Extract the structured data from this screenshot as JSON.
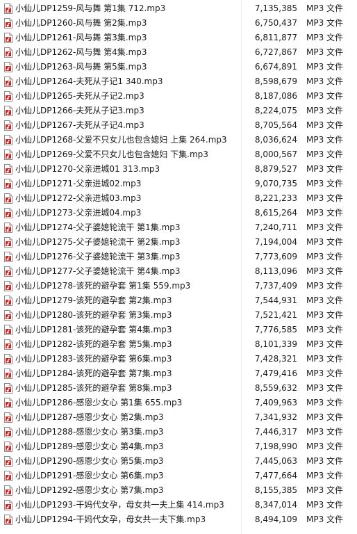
{
  "files": [
    {
      "name": "小仙儿DP1259-风与舞 第1集 712.mp3",
      "size": "7,135,385",
      "type": "MP3 文件",
      "icon": "mp3-file-icon"
    },
    {
      "name": "小仙儿DP1260-风与舞 第2集.mp3",
      "size": "6,750,437",
      "type": "MP3 文件",
      "icon": "mp3-file-icon"
    },
    {
      "name": "小仙儿DP1261-风与舞 第3集.mp3",
      "size": "6,811,877",
      "type": "MP3 文件",
      "icon": "mp3-file-icon"
    },
    {
      "name": "小仙儿DP1262-风与舞 第4集.mp3",
      "size": "6,727,867",
      "type": "MP3 文件",
      "icon": "mp3-file-icon"
    },
    {
      "name": "小仙儿DP1263-风与舞 第5集.mp3",
      "size": "6,674,891",
      "type": "MP3 文件",
      "icon": "mp3-file-icon"
    },
    {
      "name": "小仙儿DP1264-夫死从子记1 340.mp3",
      "size": "8,598,679",
      "type": "MP3 文件",
      "icon": "mp3-file-icon"
    },
    {
      "name": "小仙儿DP1265-夫死从子记2.mp3",
      "size": "8,187,086",
      "type": "MP3 文件",
      "icon": "mp3-file-icon"
    },
    {
      "name": "小仙儿DP1266-夫死从子记3.mp3",
      "size": "8,224,075",
      "type": "MP3 文件",
      "icon": "mp3-file-icon"
    },
    {
      "name": "小仙儿DP1267-夫死从子记4.mp3",
      "size": "8,705,564",
      "type": "MP3 文件",
      "icon": "mp3-file-icon"
    },
    {
      "name": "小仙儿DP1268-父爱不只女儿也包含媳妇 上集 264.mp3",
      "size": "8,036,624",
      "type": "MP3 文件",
      "icon": "mp3-file-icon"
    },
    {
      "name": "小仙儿DP1269-父爱不只女儿也包含媳妇 下集.mp3",
      "size": "8,000,567",
      "type": "MP3 文件",
      "icon": "mp3-file-icon"
    },
    {
      "name": "小仙儿DP1270-父亲进城01 313.mp3",
      "size": "8,879,527",
      "type": "MP3 文件",
      "icon": "mp3-file-icon"
    },
    {
      "name": "小仙儿DP1271-父亲进城02.mp3",
      "size": "9,070,735",
      "type": "MP3 文件",
      "icon": "mp3-file-icon"
    },
    {
      "name": "小仙儿DP1272-父亲进城03.mp3",
      "size": "8,221,233",
      "type": "MP3 文件",
      "icon": "mp3-file-icon"
    },
    {
      "name": "小仙儿DP1273-父亲进城04.mp3",
      "size": "8,615,264",
      "type": "MP3 文件",
      "icon": "mp3-file-icon"
    },
    {
      "name": "小仙儿DP1274-父子婆媳轮流干 第1集.mp3",
      "size": "7,240,711",
      "type": "MP3 文件",
      "icon": "mp3-file-icon"
    },
    {
      "name": "小仙儿DP1275-父子婆媳轮流干 第2集.mp3",
      "size": "7,194,004",
      "type": "MP3 文件",
      "icon": "mp3-file-icon"
    },
    {
      "name": "小仙儿DP1276-父子婆媳轮流干 第3集.mp3",
      "size": "7,773,609",
      "type": "MP3 文件",
      "icon": "mp3-file-icon"
    },
    {
      "name": "小仙儿DP1277-父子婆媳轮流干 第4集.mp3",
      "size": "8,113,096",
      "type": "MP3 文件",
      "icon": "mp3-file-icon"
    },
    {
      "name": "小仙儿DP1278-该死的避孕套 第1集 559.mp3",
      "size": "7,737,409",
      "type": "MP3 文件",
      "icon": "mp3-file-icon"
    },
    {
      "name": "小仙儿DP1279-该死的避孕套 第2集.mp3",
      "size": "7,544,931",
      "type": "MP3 文件",
      "icon": "mp3-file-icon"
    },
    {
      "name": "小仙儿DP1280-该死的避孕套 第3集.mp3",
      "size": "7,521,421",
      "type": "MP3 文件",
      "icon": "mp3-file-icon"
    },
    {
      "name": "小仙儿DP1281-该死的避孕套 第4集.mp3",
      "size": "7,776,585",
      "type": "MP3 文件",
      "icon": "mp3-file-icon"
    },
    {
      "name": "小仙儿DP1282-该死的避孕套 第5集.mp3",
      "size": "8,101,339",
      "type": "MP3 文件",
      "icon": "mp3-file-icon"
    },
    {
      "name": "小仙儿DP1283-该死的避孕套 第6集.mp3",
      "size": "7,428,321",
      "type": "MP3 文件",
      "icon": "mp3-file-icon"
    },
    {
      "name": "小仙儿DP1284-该死的避孕套 第7集.mp3",
      "size": "7,479,416",
      "type": "MP3 文件",
      "icon": "mp3-file-icon"
    },
    {
      "name": "小仙儿DP1285-该死的避孕套 第8集.mp3",
      "size": "8,559,632",
      "type": "MP3 文件",
      "icon": "mp3-file-icon"
    },
    {
      "name": "小仙儿DP1286-感恩少女心 第1集 655.mp3",
      "size": "7,409,963",
      "type": "MP3 文件",
      "icon": "mp3-file-icon"
    },
    {
      "name": "小仙儿DP1287-感恩少女心 第2集.mp3",
      "size": "7,341,932",
      "type": "MP3 文件",
      "icon": "mp3-file-icon"
    },
    {
      "name": "小仙儿DP1288-感恩少女心 第3集.mp3",
      "size": "7,446,317",
      "type": "MP3 文件",
      "icon": "mp3-file-icon"
    },
    {
      "name": "小仙儿DP1289-感恩少女心 第4集.mp3",
      "size": "7,198,990",
      "type": "MP3 文件",
      "icon": "mp3-file-icon"
    },
    {
      "name": "小仙儿DP1290-感恩少女心 第5集.mp3",
      "size": "7,445,063",
      "type": "MP3 文件",
      "icon": "mp3-file-icon"
    },
    {
      "name": "小仙儿DP1291-感恩少女心 第6集.mp3",
      "size": "7,477,664",
      "type": "MP3 文件",
      "icon": "mp3-file-icon"
    },
    {
      "name": "小仙儿DP1292-感恩少女心 第7集.mp3",
      "size": "8,155,385",
      "type": "MP3 文件",
      "icon": "mp3-file-icon"
    },
    {
      "name": "小仙儿DP1293-干妈代女孕，母女共一夫上集 414.mp3",
      "size": "8,347,014",
      "type": "MP3 文件",
      "icon": "mp3-file-icon"
    },
    {
      "name": "小仙儿DP1294-干妈代女孕，母女共一夫下集.mp3",
      "size": "8,494,109",
      "type": "MP3 文件",
      "icon": "mp3-file-icon"
    }
  ]
}
